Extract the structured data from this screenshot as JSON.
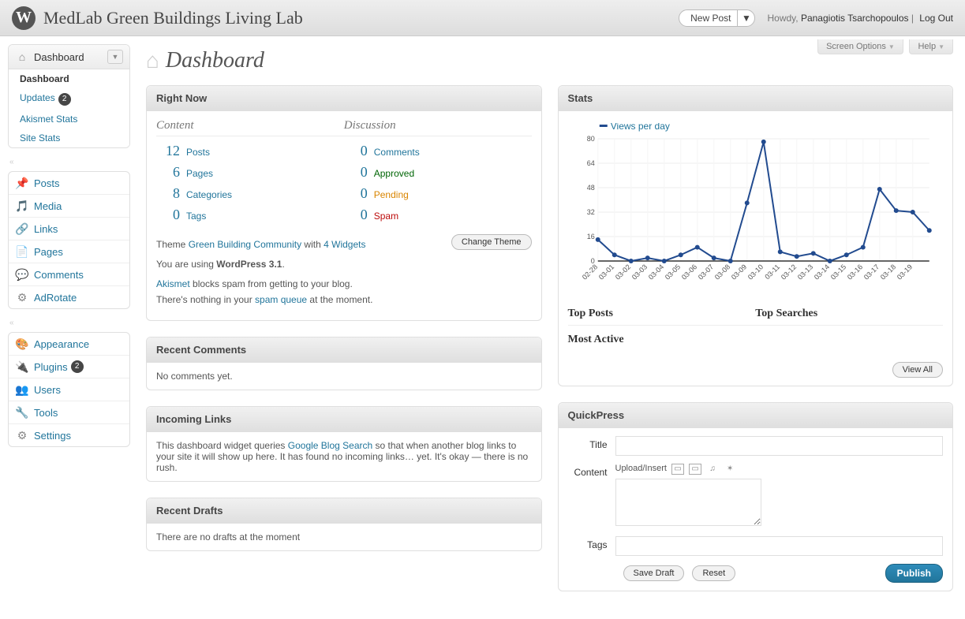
{
  "header": {
    "site_title": "MedLab Green Buildings Living Lab",
    "new_post": "New Post",
    "howdy_prefix": "Howdy, ",
    "username": "Panagiotis Tsarchopoulos",
    "logout": "Log Out"
  },
  "screen_tabs": {
    "screen_options": "Screen Options",
    "help": "Help"
  },
  "page_title": "Dashboard",
  "sidebar": {
    "group1": {
      "top": "Dashboard",
      "sub": [
        {
          "label": "Dashboard",
          "current": true
        },
        {
          "label": "Updates",
          "badge": "2"
        },
        {
          "label": "Akismet Stats"
        },
        {
          "label": "Site Stats"
        }
      ]
    },
    "group2": [
      {
        "label": "Posts",
        "icon": "pin"
      },
      {
        "label": "Media",
        "icon": "media"
      },
      {
        "label": "Links",
        "icon": "link"
      },
      {
        "label": "Pages",
        "icon": "page"
      },
      {
        "label": "Comments",
        "icon": "comment"
      },
      {
        "label": "AdRotate",
        "icon": "gear"
      }
    ],
    "group3": [
      {
        "label": "Appearance",
        "icon": "appearance"
      },
      {
        "label": "Plugins",
        "icon": "plugin",
        "badge": "2"
      },
      {
        "label": "Users",
        "icon": "users"
      },
      {
        "label": "Tools",
        "icon": "tools"
      },
      {
        "label": "Settings",
        "icon": "settings"
      }
    ]
  },
  "right_now": {
    "title": "Right Now",
    "content_heading": "Content",
    "discussion_heading": "Discussion",
    "content_rows": [
      {
        "num": "12",
        "label": "Posts"
      },
      {
        "num": "6",
        "label": "Pages"
      },
      {
        "num": "8",
        "label": "Categories"
      },
      {
        "num": "0",
        "label": "Tags"
      }
    ],
    "discussion_rows": [
      {
        "num": "0",
        "label": "Comments",
        "cls": ""
      },
      {
        "num": "0",
        "label": "Approved",
        "cls": "approved"
      },
      {
        "num": "0",
        "label": "Pending",
        "cls": "pending"
      },
      {
        "num": "0",
        "label": "Spam",
        "cls": "spam"
      }
    ],
    "theme_prefix": "Theme ",
    "theme_name": "Green Building Community",
    "theme_with": " with ",
    "widgets": "4 Widgets",
    "change_theme": "Change Theme",
    "wp_prefix": "You are using ",
    "wp_version": "WordPress 3.1",
    "wp_suffix": ".",
    "akismet_link": "Akismet",
    "akismet_text": " blocks spam from getting to your blog.",
    "spam_queue_prefix": "There's nothing in your ",
    "spam_queue_link": "spam queue",
    "spam_queue_suffix": " at the moment."
  },
  "recent_comments": {
    "title": "Recent Comments",
    "body": "No comments yet."
  },
  "incoming_links": {
    "title": "Incoming Links",
    "prefix": "This dashboard widget queries ",
    "link": "Google Blog Search",
    "suffix": " so that when another blog links to your site it will show up here. It has found no incoming links… yet. It's okay — there is no rush."
  },
  "recent_drafts": {
    "title": "Recent Drafts",
    "body": "There are no drafts at the moment"
  },
  "stats": {
    "title": "Stats",
    "legend": "Views per day",
    "top_posts": "Top Posts",
    "top_searches": "Top Searches",
    "most_active": "Most Active",
    "view_all": "View All"
  },
  "quickpress": {
    "title": "QuickPress",
    "title_label": "Title",
    "content_label": "Content",
    "upload_insert": "Upload/Insert",
    "tags_label": "Tags",
    "save_draft": "Save Draft",
    "reset": "Reset",
    "publish": "Publish"
  },
  "chart_data": {
    "type": "line",
    "title": "",
    "series_name": "Views per day",
    "ylim": [
      0,
      80
    ],
    "yticks": [
      0,
      16,
      32,
      48,
      64,
      80
    ],
    "categories": [
      "02-28",
      "03-01",
      "03-02",
      "03-03",
      "03-04",
      "03-05",
      "03-06",
      "03-07",
      "03-08",
      "03-09",
      "03-10",
      "03-11",
      "03-12",
      "03-13",
      "03-14",
      "03-15",
      "03-16",
      "03-17",
      "03-18",
      "03-19"
    ],
    "values": [
      14,
      4,
      0,
      2,
      0,
      4,
      9,
      2,
      0,
      38,
      78,
      6,
      3,
      5,
      0,
      4,
      9,
      47,
      33,
      32,
      20
    ]
  }
}
